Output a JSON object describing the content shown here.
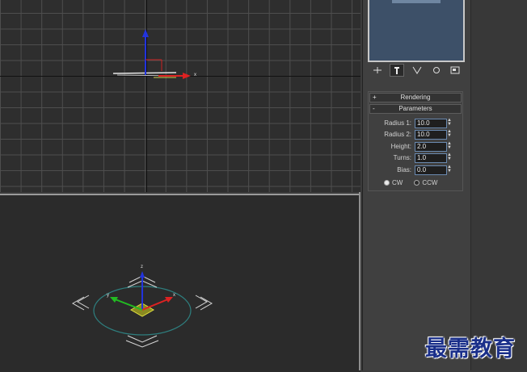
{
  "top_viewport": {
    "gizmo": {
      "x_axis_label": "x"
    }
  },
  "perspective_viewport": {
    "gizmo": {
      "x_label": "x",
      "y_label": "y",
      "z_label": "z"
    }
  },
  "command_panel": {
    "toolbar": [
      {
        "icon": "create-icon"
      },
      {
        "icon": "modify-icon"
      },
      {
        "icon": "hierarchy-icon"
      },
      {
        "icon": "motion-icon"
      },
      {
        "icon": "display-icon"
      }
    ],
    "rollouts": {
      "rendering": {
        "sign": "+",
        "title": "Rendering"
      },
      "parameters": {
        "sign": "-",
        "title": "Parameters"
      }
    },
    "params": [
      {
        "label": "Radius 1:",
        "value": "10.0"
      },
      {
        "label": "Radius 2:",
        "value": "10.0"
      },
      {
        "label": "Height:",
        "value": "2.0"
      },
      {
        "label": "Turns:",
        "value": "1.0"
      },
      {
        "label": "Bias:",
        "value": "0.0"
      }
    ],
    "direction": {
      "cw": "CW",
      "ccw": "CCW",
      "selected": "CW"
    }
  },
  "watermark": {
    "text": "最需教育"
  }
}
